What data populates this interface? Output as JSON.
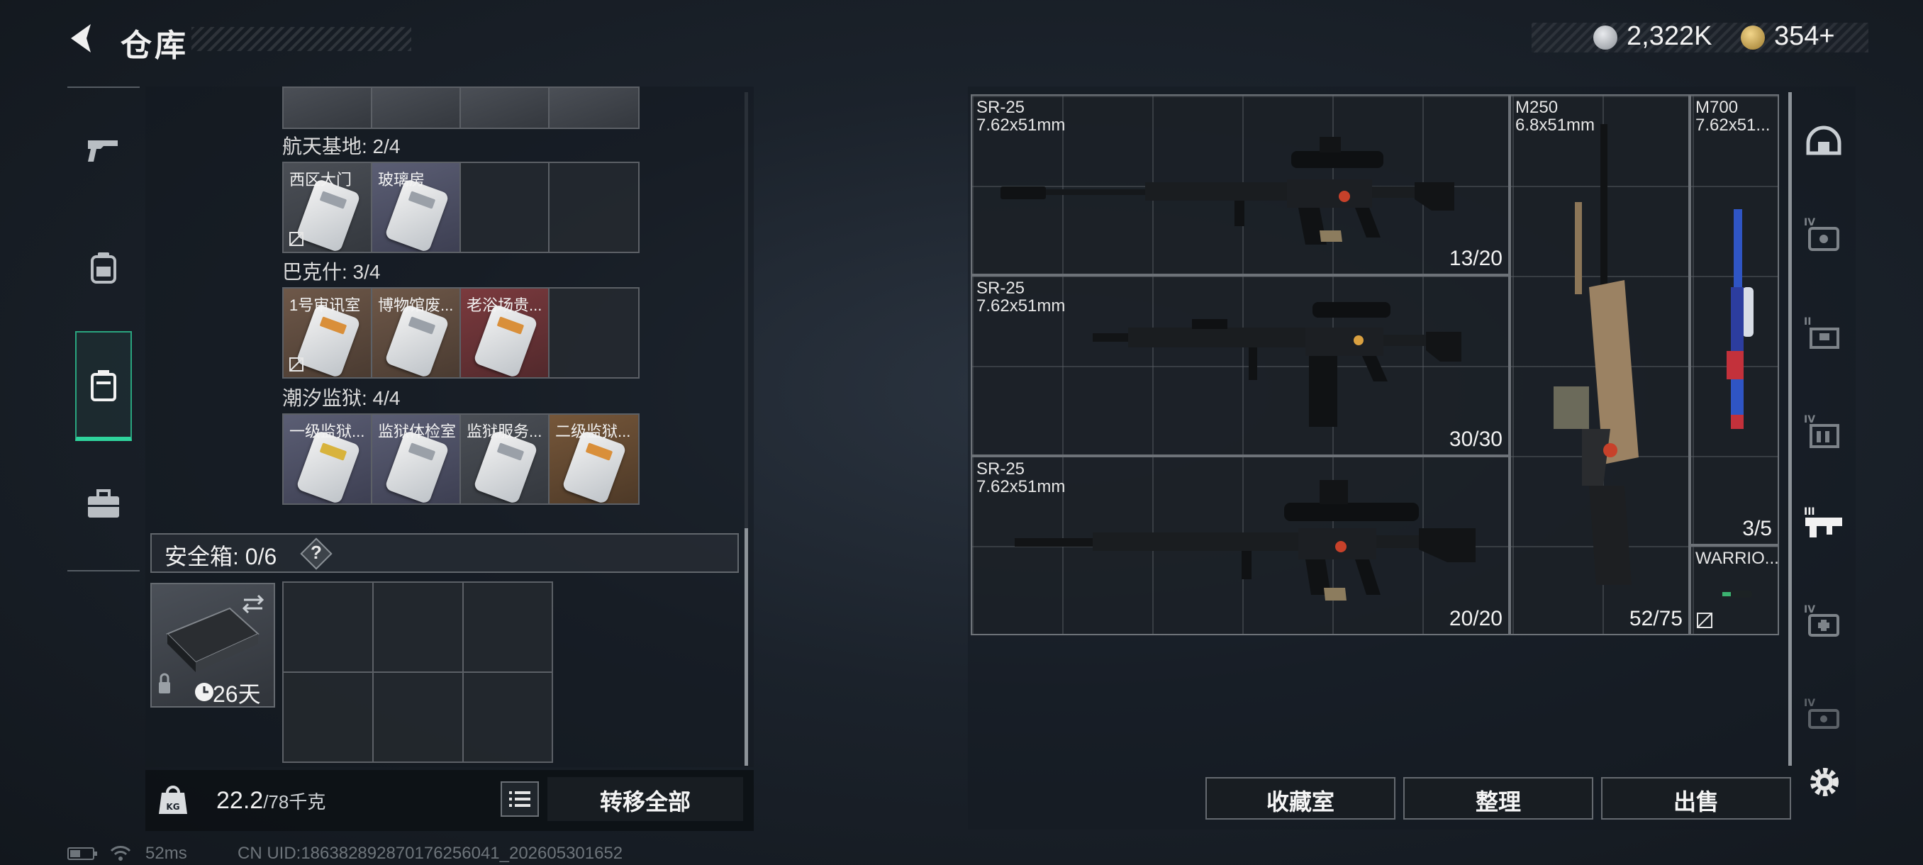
{
  "header": {
    "title": "仓库",
    "currency": [
      {
        "icon": "silver-coin-icon",
        "value": "2,322K"
      },
      {
        "icon": "gold-coin-icon",
        "value": "354+"
      }
    ]
  },
  "left_rail": [
    {
      "icon": "pistol-icon"
    },
    {
      "icon": "backpack-icon"
    },
    {
      "icon": "container-icon",
      "active": true
    },
    {
      "icon": "briefcase-icon"
    }
  ],
  "key_groups": [
    {
      "title": "航天基地: 2/4",
      "cards": [
        {
          "label": "西区大门",
          "style": "grey",
          "tag": "plain",
          "unsellable": true
        },
        {
          "label": "玻璃房",
          "style": "blue",
          "tag": "plain"
        },
        {
          "label": "",
          "style": "empty"
        },
        {
          "label": "",
          "style": "empty"
        }
      ]
    },
    {
      "title": "巴克什: 3/4",
      "cards": [
        {
          "label": "1号审讯室",
          "style": "brown",
          "tag": "orange",
          "unsellable": true
        },
        {
          "label": "博物馆废...",
          "style": "brown",
          "tag": "plain"
        },
        {
          "label": "老浴场贵...",
          "style": "red",
          "tag": "orange"
        },
        {
          "label": "",
          "style": "empty"
        }
      ]
    },
    {
      "title": "潮汐监狱: 4/4",
      "cards": [
        {
          "label": "一级监狱...",
          "style": "blue",
          "tag": "yellow"
        },
        {
          "label": "监狱体检室",
          "style": "blue",
          "tag": "plain"
        },
        {
          "label": "监狱服务...",
          "style": "grey",
          "tag": "plain"
        },
        {
          "label": "二级监狱...",
          "style": "orange",
          "tag": "orange"
        }
      ]
    }
  ],
  "safe_box": {
    "title": "安全箱: 0/6",
    "help": "?",
    "days": "26天"
  },
  "weight": {
    "current": "22.2",
    "max": "/78千克"
  },
  "transfer_all": "转移全部",
  "status": {
    "ping": "52ms",
    "uid": "CN UID:186382892870176256041_202605301652"
  },
  "weapons": [
    {
      "name": "SR-25",
      "caliber": "7.62x51mm",
      "count": "13/20",
      "color": "black"
    },
    {
      "name": "SR-25",
      "caliber": "7.62x51mm",
      "count": "30/30",
      "color": "black"
    },
    {
      "name": "SR-25",
      "caliber": "7.62x51mm",
      "count": "20/20",
      "color": "black"
    },
    {
      "name": "M250",
      "caliber": "6.8x51mm",
      "count": "52/75",
      "color": "tan"
    },
    {
      "name": "M700",
      "caliber": "7.62x51...",
      "count": "3/5",
      "color": "blue"
    },
    {
      "name": "WARRIO...",
      "caliber": "",
      "count": "",
      "color": "green",
      "unsellable": true
    }
  ],
  "right_rail": [
    {
      "icon": "helmet-icon"
    },
    {
      "icon": "armor-iv-icon"
    },
    {
      "icon": "armor-ii-icon"
    },
    {
      "icon": "chest-rig-iv-icon"
    },
    {
      "icon": "weapon-tier-iii-icon",
      "active": true
    },
    {
      "icon": "medical-iv-icon"
    },
    {
      "icon": "misc-iv-icon"
    }
  ],
  "actions": {
    "collection": "收藏室",
    "sort": "整理",
    "sell": "出售"
  }
}
